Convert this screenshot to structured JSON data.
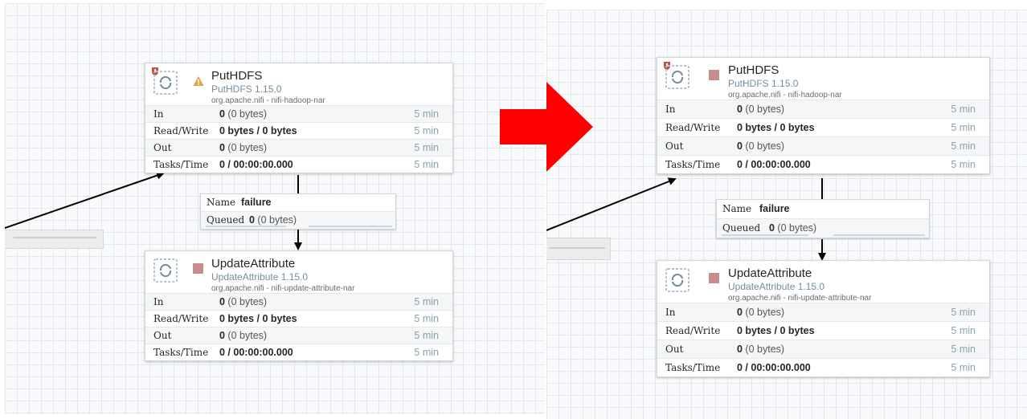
{
  "processors": {
    "put_hdfs": {
      "name": "PutHDFS",
      "type": "PutHDFS 1.15.0",
      "bundle": "org.apache.nifi - nifi-hadoop-nar",
      "stats": [
        {
          "label": "In",
          "bold": "0",
          "rest": " (0 bytes)",
          "time": "5 min"
        },
        {
          "label": "Read/Write",
          "bold": "0 bytes / 0 bytes",
          "rest": "",
          "time": "5 min"
        },
        {
          "label": "Out",
          "bold": "0",
          "rest": " (0 bytes)",
          "time": "5 min"
        },
        {
          "label": "Tasks/Time",
          "bold": "0 / 00:00:00.000",
          "rest": "",
          "time": "5 min"
        }
      ]
    },
    "update_attribute": {
      "name": "UpdateAttribute",
      "type": "UpdateAttribute 1.15.0",
      "bundle": "org.apache.nifi - nifi-update-attribute-nar",
      "stats": [
        {
          "label": "In",
          "bold": "0",
          "rest": " (0 bytes)",
          "time": "5 min"
        },
        {
          "label": "Read/Write",
          "bold": "0 bytes / 0 bytes",
          "rest": "",
          "time": "5 min"
        },
        {
          "label": "Out",
          "bold": "0",
          "rest": " (0 bytes)",
          "time": "5 min"
        },
        {
          "label": "Tasks/Time",
          "bold": "0 / 00:00:00.000",
          "rest": "",
          "time": "5 min"
        }
      ]
    }
  },
  "connection": {
    "name_label": "Name",
    "name_value": "failure",
    "queued_label": "Queued",
    "queued_count": "0",
    "queued_size": " (0 bytes)"
  },
  "states": {
    "before": {
      "put_hdfs_status": "invalid-warning",
      "update_attribute_status": "stopped"
    },
    "after": {
      "put_hdfs_status": "stopped",
      "update_attribute_status": "stopped"
    }
  },
  "colors": {
    "transition_arrow": "#ff0000",
    "stopped": "#c98c8c",
    "warning": "#d9a441",
    "restricted": "#ba554a",
    "processor_type": "#728e9b",
    "time": "#8aa1ac"
  }
}
